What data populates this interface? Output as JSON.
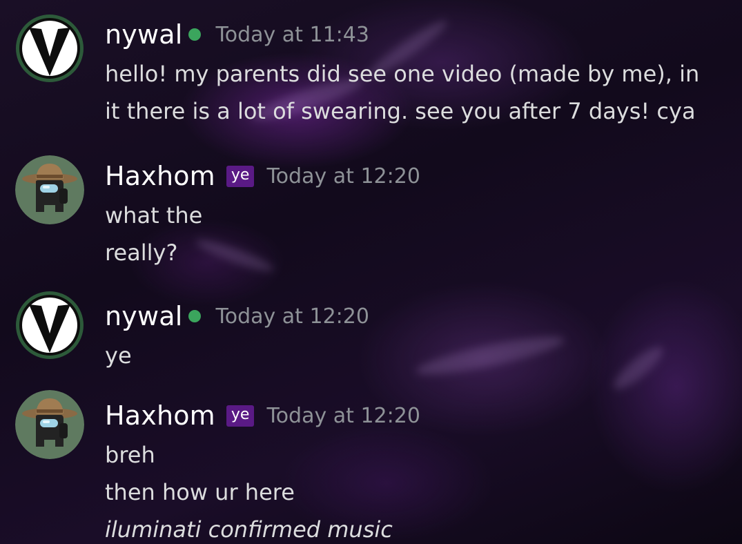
{
  "messages": [
    {
      "author": "nywal",
      "online": true,
      "avatar_icon": "black-v-logo-icon",
      "timestamp": "Today at 11:43",
      "lines": [
        "hello! my parents did see one video (made by me), in",
        "it there is a lot of swearing. see you after 7 days! cya"
      ]
    },
    {
      "author": "Haxhom",
      "role_tag": "ye",
      "avatar_icon": "crewmate-hat-icon",
      "timestamp": "Today at 12:20",
      "lines": [
        "what the",
        "really?"
      ]
    },
    {
      "author": "nywal",
      "online": true,
      "avatar_icon": "black-v-logo-icon",
      "timestamp": "Today at 12:20",
      "lines": [
        "ye"
      ]
    },
    {
      "author": "Haxhom",
      "role_tag": "ye",
      "avatar_icon": "crewmate-hat-icon",
      "timestamp": "Today at 12:20",
      "lines": [
        "breh",
        "then how ur here",
        "iluminati confirmed music"
      ]
    }
  ],
  "colors": {
    "online": "#3ba55d",
    "role_tag": "#5a1a85",
    "timestamp": "#8e9297",
    "username": "#ffffff",
    "text": "#dcddde"
  }
}
